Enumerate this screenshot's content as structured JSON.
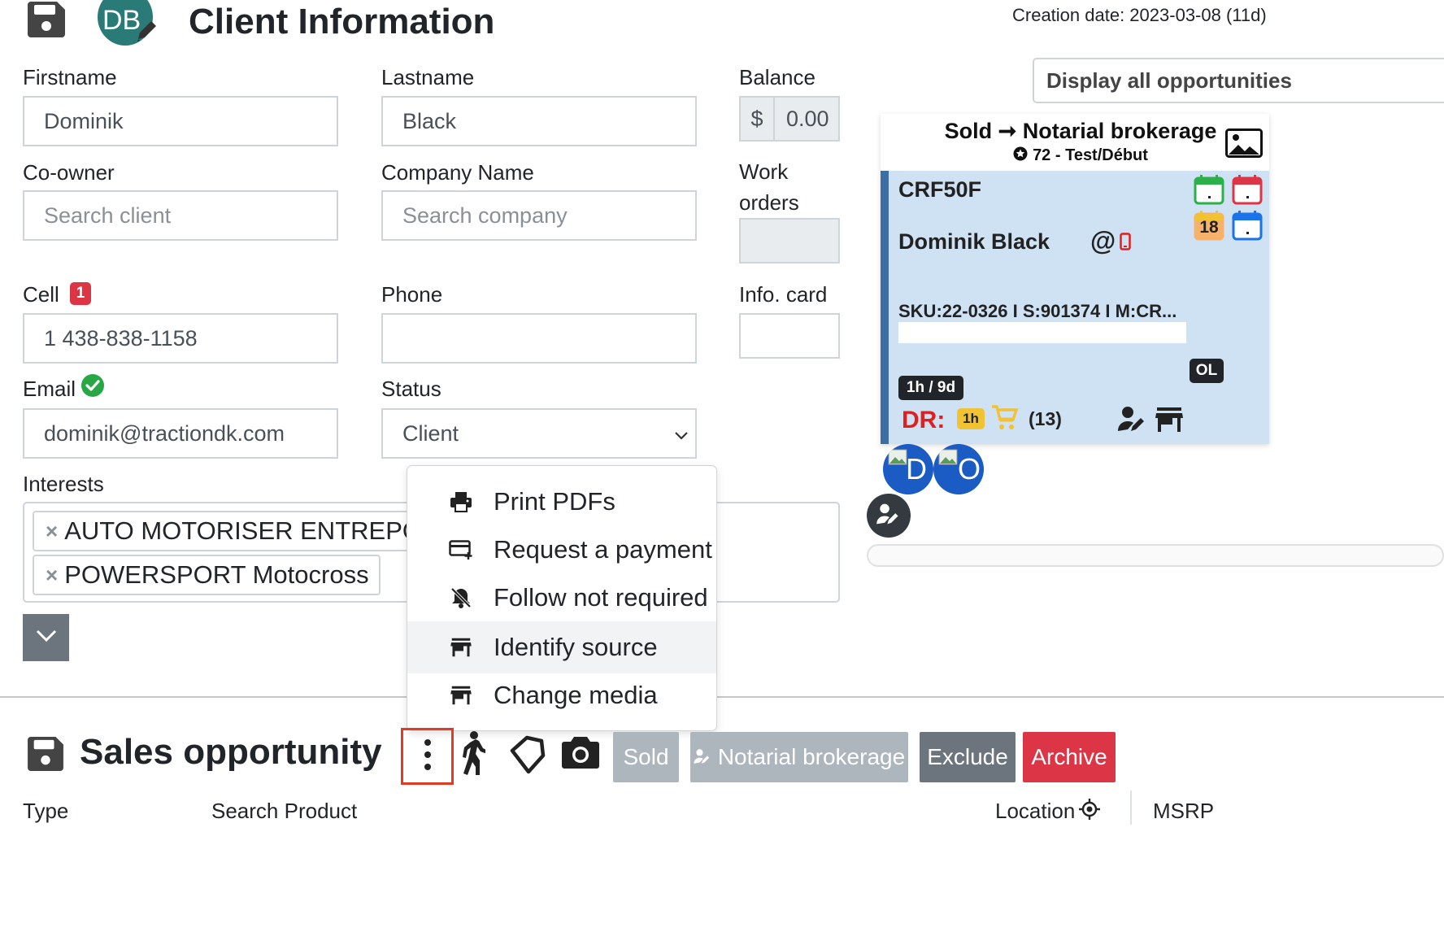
{
  "header": {
    "title": "Client Information",
    "avatar_initials": "DB",
    "creation_date": "Creation date: 2023-03-08 (11d)"
  },
  "form": {
    "firstname": {
      "label": "Firstname",
      "value": "Dominik"
    },
    "lastname": {
      "label": "Lastname",
      "value": "Black"
    },
    "balance": {
      "label": "Balance",
      "currency": "$",
      "value": "0.00"
    },
    "coowner": {
      "label": "Co-owner",
      "placeholder": "Search client"
    },
    "company": {
      "label": "Company Name",
      "placeholder": "Search company"
    },
    "work_orders": {
      "label_line1": "Work",
      "label_line2": "orders"
    },
    "cell": {
      "label": "Cell",
      "badge": "1",
      "value": "1 438-838-1158"
    },
    "phone": {
      "label": "Phone",
      "value": ""
    },
    "info_card": {
      "label": "Info. card",
      "value": ""
    },
    "email": {
      "label": "Email",
      "value": "dominik@tractiondk.com"
    },
    "status": {
      "label": "Status",
      "value": "Client"
    },
    "interests": {
      "label": "Interests",
      "chips": [
        "AUTO MOTORISER ENTREPOSAGE",
        "POWERSPORT Motocross"
      ]
    }
  },
  "context_menu": {
    "items": [
      {
        "label": "Print PDFs",
        "icon": "printer-icon"
      },
      {
        "label": "Request a payment",
        "icon": "credit-card-plus-icon"
      },
      {
        "label": "Follow not required",
        "icon": "bell-off-icon"
      },
      {
        "label": "Identify source",
        "icon": "store-icon",
        "highlighted": true
      },
      {
        "label": "Change media",
        "icon": "store-icon"
      }
    ]
  },
  "right_panel": {
    "display_all_button": "Display all opportunities",
    "card": {
      "title": "Sold ➞ Notarial brokerage",
      "subtitle": "72 - Test/Début",
      "code": "CRF50F",
      "client_name": "Dominik Black",
      "at_symbol": "@",
      "calendar_number": "18",
      "sku_line": "SKU:22-0326 I S:901374 I M:CR...",
      "ol_tag": "OL",
      "time_tag": "1h / 9d",
      "dr_label": "DR:",
      "dr_time": "1h",
      "cart_count": "(13)"
    },
    "avatars": [
      "D",
      "O"
    ]
  },
  "sales": {
    "title": "Sales opportunity",
    "buttons": {
      "sold": "Sold",
      "notarial": "Notarial brokerage",
      "exclude": "Exclude",
      "archive": "Archive"
    },
    "columns": {
      "type": "Type",
      "search_product": "Search Product",
      "location": "Location",
      "msrp": "MSRP"
    }
  },
  "colors": {
    "archive": "#dc3545",
    "exclude": "#6c757d",
    "sold": "#adb5bd",
    "card_bg": "#cfe2f3",
    "card_border": "#3a6ea5",
    "highlight_box": "#e03b24",
    "avatar": "#2a7a78"
  }
}
